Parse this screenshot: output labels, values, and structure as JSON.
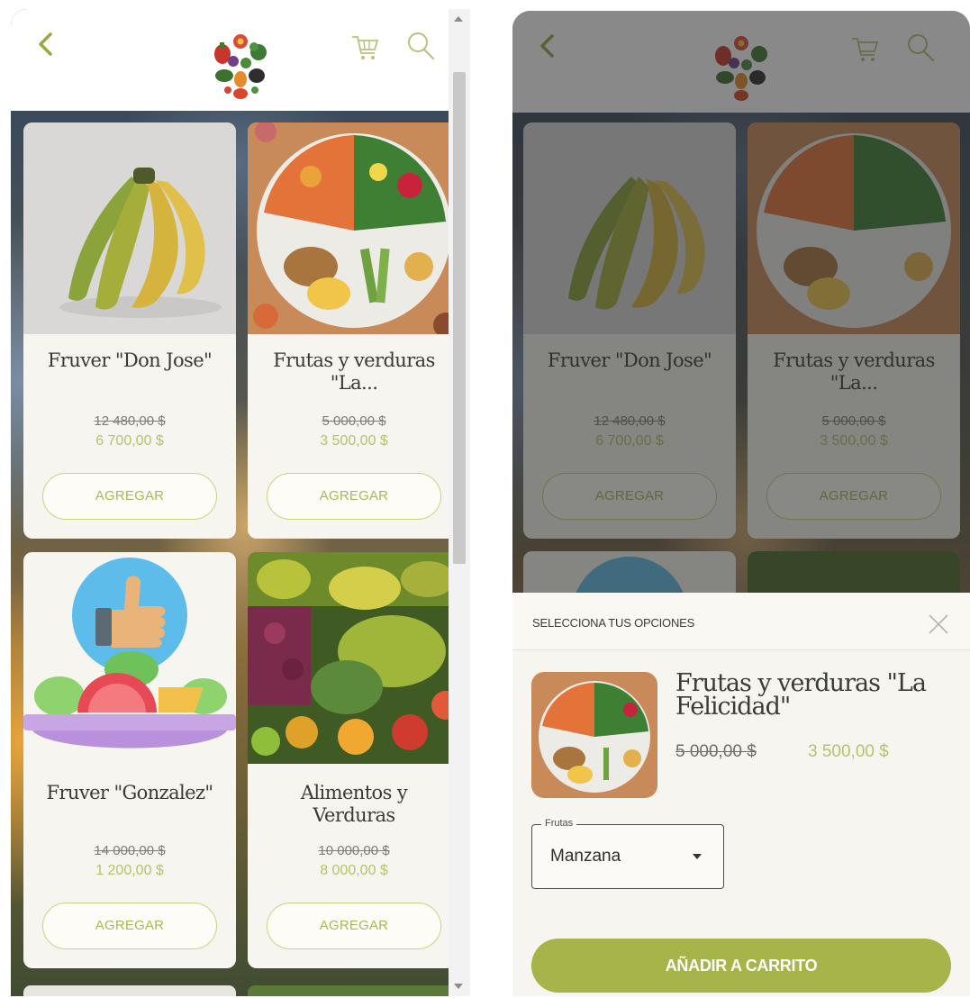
{
  "colors": {
    "accent": "#a6b44a",
    "price_new": "#b5c46a",
    "card_bg": "#f6f5f0"
  },
  "header": {
    "back_icon": "chevron-left-icon",
    "logo": "vegetable-basket-logo",
    "cart_icon": "cart-icon",
    "search_icon": "search-icon"
  },
  "products": [
    {
      "name": "Fruver \"Don Jose\"",
      "old_price": "12 480,00 $",
      "new_price": "6 700,00 $",
      "button": "AGREGAR"
    },
    {
      "name": "Frutas y verduras \"La...",
      "old_price": "5 000,00 $",
      "new_price": "3 500,00 $",
      "button": "AGREGAR"
    },
    {
      "name": "Fruver \"Gonzalez\"",
      "old_price": "14 000,00 $",
      "new_price": "1 200,00 $",
      "button": "AGREGAR"
    },
    {
      "name": "Alimentos y Verduras",
      "old_price": "10 000,00 $",
      "new_price": "8 000,00 $",
      "button": "AGREGAR"
    }
  ],
  "sheet": {
    "title": "SELECCIONA TUS OPCIONES",
    "product_name": "Frutas y verduras \"La Felicidad\"",
    "old_price": "5 000,00 $",
    "new_price": "3 500,00 $",
    "select_label": "Frutas",
    "select_value": "Manzana",
    "cta": "AÑADIR A CARRITO"
  }
}
